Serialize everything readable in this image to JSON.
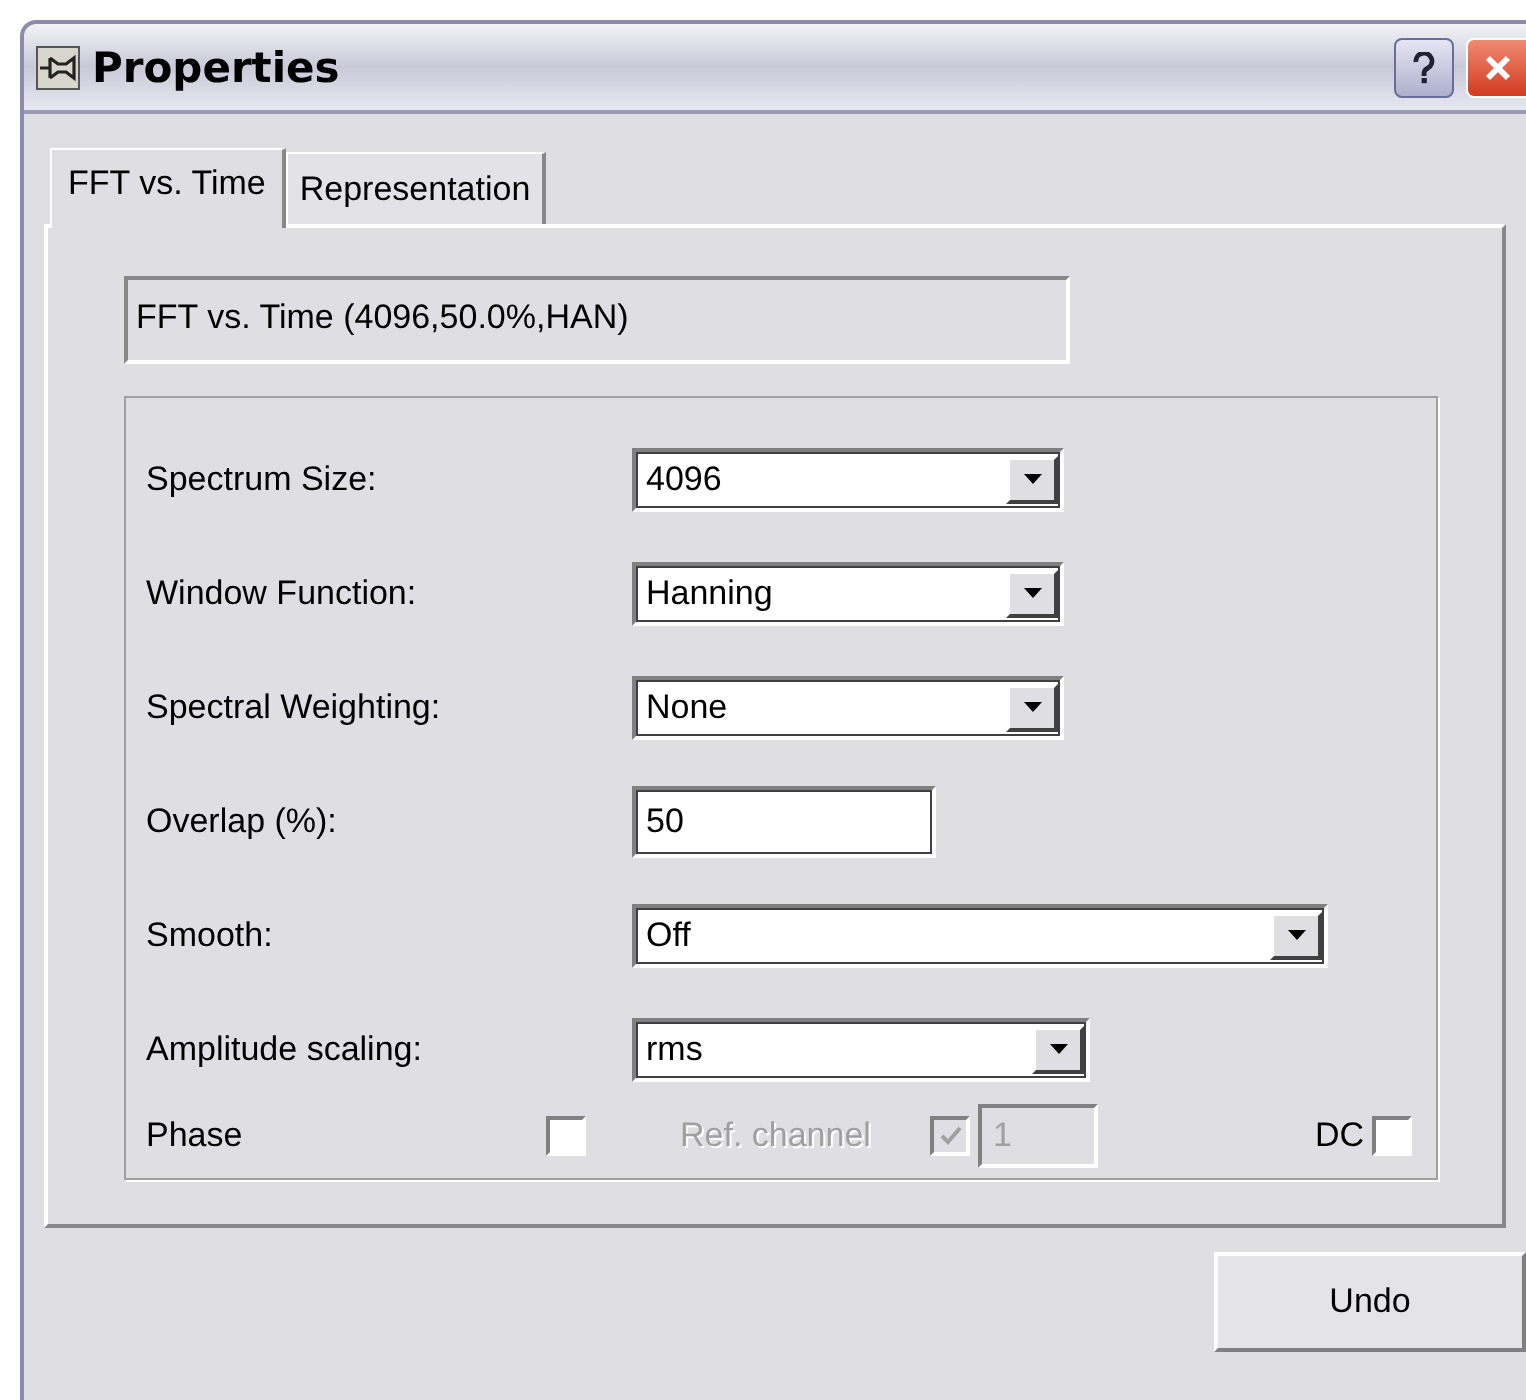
{
  "window": {
    "title": "Properties"
  },
  "tabs": [
    {
      "label": "FFT vs. Time",
      "selected": true
    },
    {
      "label": "Representation",
      "selected": false
    }
  ],
  "summary": "FFT vs. Time (4096,50.0%,HAN)",
  "settings": [
    {
      "kind": "combo",
      "label": "Spectrum Size:",
      "value": "4096"
    },
    {
      "kind": "combo",
      "label": "Window Function:",
      "value": "Hanning"
    },
    {
      "kind": "combo",
      "label": "Spectral Weighting:",
      "value": "None"
    },
    {
      "kind": "input",
      "label": "Overlap (%):",
      "value": "50"
    },
    {
      "kind": "combo",
      "label": "Smooth:",
      "value": "Off"
    },
    {
      "kind": "combo",
      "label": "Amplitude scaling:",
      "value": "rms"
    }
  ],
  "phase": {
    "label": "Phase",
    "checked": false
  },
  "ref_channel": {
    "label": "Ref. channel",
    "checked": true,
    "disabled": true,
    "value": "1"
  },
  "dc": {
    "label": "DC",
    "checked": false
  },
  "buttons": [
    "Undo"
  ]
}
